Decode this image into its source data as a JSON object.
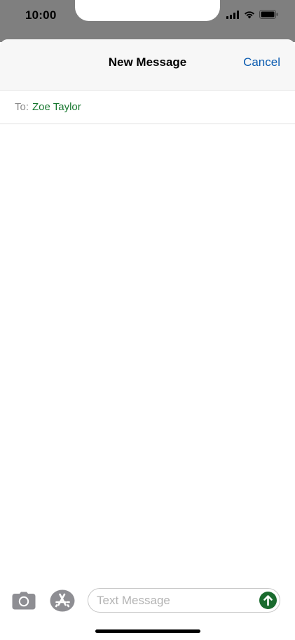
{
  "status_bar": {
    "time": "10:00",
    "signal_icon": "cellular-signal-icon",
    "wifi_icon": "wifi-icon",
    "battery_icon": "battery-icon"
  },
  "nav": {
    "title": "New Message",
    "cancel_label": "Cancel"
  },
  "recipient": {
    "label": "To:",
    "name": "Zoe Taylor"
  },
  "composer": {
    "camera_icon": "camera-icon",
    "apps_icon": "app-store-icon",
    "message_value": "",
    "message_placeholder": "Text Message",
    "send_icon": "send-arrow-icon"
  },
  "colors": {
    "accent_blue": "#0a5bb0",
    "recipient_green": "#17772f",
    "send_green": "#1a6b2e",
    "status_bg": "#7f7f7f",
    "nav_bg": "#f7f7f7"
  }
}
